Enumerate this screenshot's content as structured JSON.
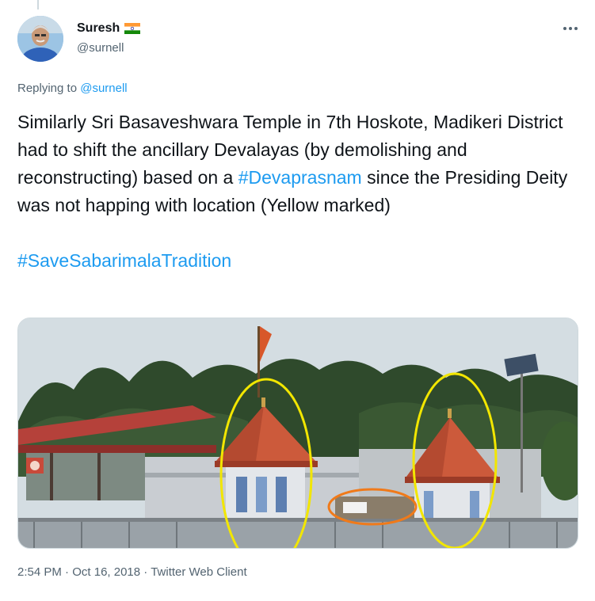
{
  "author": {
    "display_name": "Suresh",
    "flag_icon": "india-flag-icon",
    "handle": "@surnell"
  },
  "reply": {
    "prefix": "Replying to ",
    "mention": "@surnell"
  },
  "tweet": {
    "line1": "Similarly Sri Basaveshwara Temple in 7th Hoskote, Madikeri District had to shift the ancillary Devalayas (by demolishing and reconstructing) based on a ",
    "hashtag1": "#Devaprasnam",
    "line2": " since the Presiding Deity was not happing with location (Yellow marked)",
    "hashtag2": "#SaveSabarimalaTradition"
  },
  "media": {
    "alt": "Temple photo with yellow and orange marked circles",
    "marker_colors": {
      "yellow": "#f2e600",
      "orange": "#f07a1a"
    }
  },
  "meta": {
    "time": "2:54 PM",
    "separator": " · ",
    "date": "Oct 16, 2018",
    "client": "Twitter Web Client"
  },
  "colors": {
    "accent": "#1d9bf0",
    "muted": "#536471",
    "text": "#0f1419"
  }
}
